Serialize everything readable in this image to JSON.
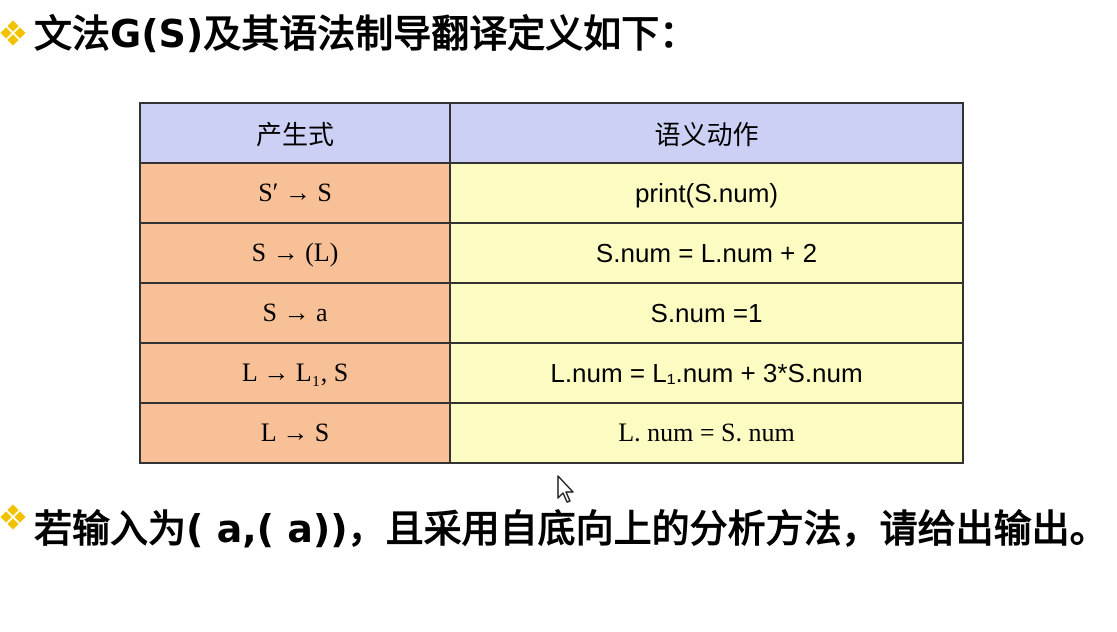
{
  "heading": "文法G(S)及其语法制导翻译定义如下：",
  "table": {
    "headers": [
      "产生式",
      "语义动作"
    ],
    "rows": [
      {
        "production": "S′ → S",
        "action": "print(S.num)"
      },
      {
        "production": "S → (L)",
        "action": "S.num = L.num + 2"
      },
      {
        "production": "S → a",
        "action": "S.num =1"
      },
      {
        "production": "L → L₁, S",
        "action": "L.num = L₁.num + 3*S.num"
      },
      {
        "production": "L → S",
        "action": "L. num = S. num"
      }
    ]
  },
  "question": "若输入为( a,( a))，且采用自底向上的分析方法，请给出输出。",
  "colors": {
    "header_bg": "#cdd0f5",
    "production_bg": "#f8c097",
    "action_bg": "#fcfcc2",
    "bullet": "#f2c200"
  },
  "icons": {
    "bullet": "diamond-bullet-icon",
    "cursor": "mouse-pointer-icon"
  }
}
